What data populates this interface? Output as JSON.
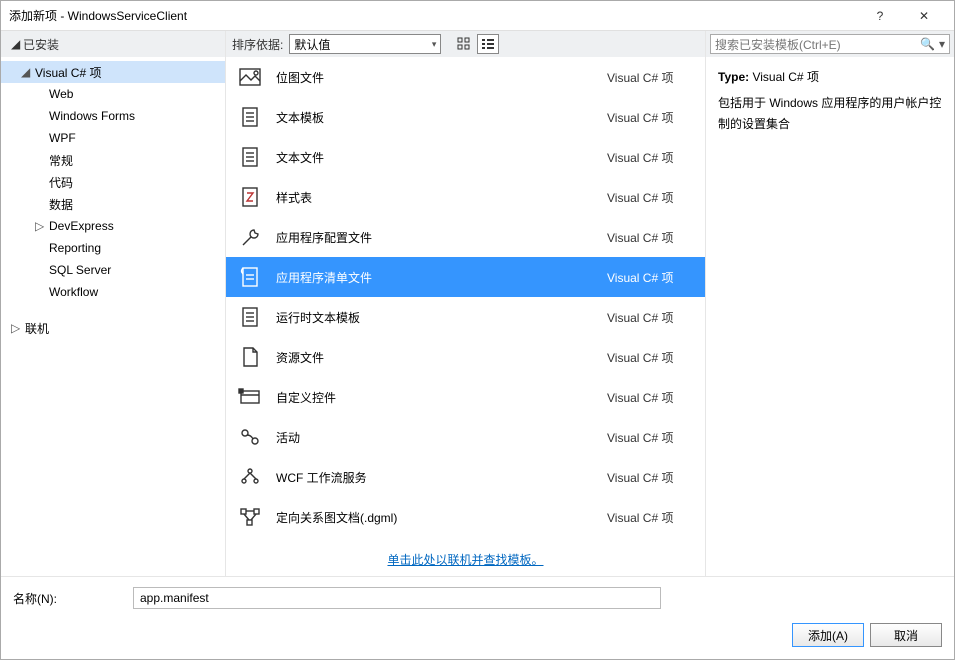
{
  "window": {
    "title": "添加新项 - WindowsServiceClient"
  },
  "left": {
    "installed_label": "已安装",
    "online_label": "联机",
    "tree": {
      "root": "Visual C# 项",
      "children": [
        "Web",
        "Windows Forms",
        "WPF",
        "常规",
        "代码",
        "数据",
        "DevExpress",
        "Reporting",
        "SQL Server",
        "Workflow"
      ],
      "devexpress_index": 6
    }
  },
  "center": {
    "sort_label": "排序依据:",
    "sort_value": "默认值",
    "templates": [
      {
        "icon": "image",
        "name": "位图文件",
        "type": "Visual C# 项"
      },
      {
        "icon": "doc",
        "name": "文本模板",
        "type": "Visual C# 项"
      },
      {
        "icon": "doc",
        "name": "文本文件",
        "type": "Visual C# 项"
      },
      {
        "icon": "style",
        "name": "样式表",
        "type": "Visual C# 项"
      },
      {
        "icon": "wrench",
        "name": "应用程序配置文件",
        "type": "Visual C# 项"
      },
      {
        "icon": "manifest",
        "name": "应用程序清单文件",
        "type": "Visual C# 项",
        "selected": true
      },
      {
        "icon": "doc",
        "name": "运行时文本模板",
        "type": "Visual C# 项"
      },
      {
        "icon": "page",
        "name": "资源文件",
        "type": "Visual C# 项"
      },
      {
        "icon": "control",
        "name": "自定义控件",
        "type": "Visual C# 项"
      },
      {
        "icon": "activity",
        "name": "活动",
        "type": "Visual C# 项"
      },
      {
        "icon": "workflow",
        "name": "WCF 工作流服务",
        "type": "Visual C# 项"
      },
      {
        "icon": "graph",
        "name": "定向关系图文档(.dgml)",
        "type": "Visual C# 项"
      }
    ],
    "online_search_link": "单击此处以联机并查找模板。"
  },
  "right": {
    "search_placeholder": "搜索已安装模板(Ctrl+E)",
    "type_label": "Type:",
    "type_value": "Visual C# 项",
    "description": "包括用于 Windows 应用程序的用户帐户控制的设置集合"
  },
  "bottom": {
    "name_label": "名称(N):",
    "name_value": "app.manifest",
    "add_btn": "添加(A)",
    "cancel_btn": "取消"
  }
}
